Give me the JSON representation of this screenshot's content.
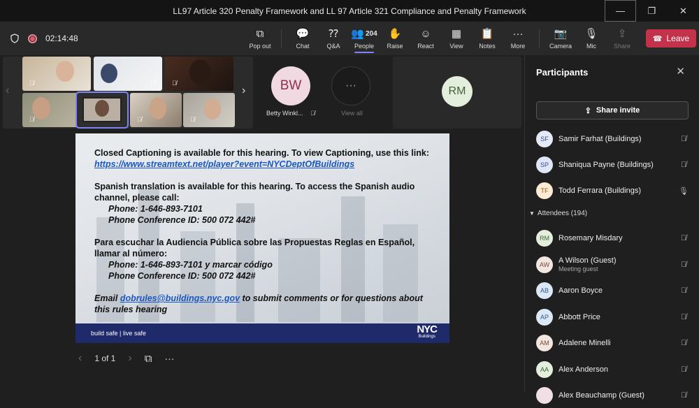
{
  "window": {
    "title": "LL97 Article 320 Penalty Framework and LL 97 Article 321 Compliance and Penalty Framework",
    "minimize": "—",
    "restore": "❐",
    "close": "✕"
  },
  "toolbar": {
    "timer": "02:14:48",
    "buttons": [
      {
        "label": "Pop out",
        "icon": "popout-icon",
        "glyph": "⧉"
      },
      {
        "label": "Chat",
        "icon": "chat-icon",
        "glyph": "💬"
      },
      {
        "label": "Q&A",
        "icon": "qa-icon",
        "glyph": "⁇"
      },
      {
        "label": "People",
        "icon": "people-icon",
        "glyph": "👥",
        "count": "204"
      },
      {
        "label": "Raise",
        "icon": "hand-icon",
        "glyph": "✋"
      },
      {
        "label": "React",
        "icon": "smile-icon",
        "glyph": "☺"
      },
      {
        "label": "View",
        "icon": "view-icon",
        "glyph": "▦"
      },
      {
        "label": "Notes",
        "icon": "notes-icon",
        "glyph": "📋"
      },
      {
        "label": "More",
        "icon": "more-icon",
        "glyph": "···"
      },
      {
        "label": "Camera",
        "icon": "camera-off-icon",
        "glyph": "📷"
      },
      {
        "label": "Mic",
        "icon": "mic-off-icon",
        "glyph": "🎙"
      },
      {
        "label": "Share",
        "icon": "share-icon",
        "glyph": "⇪"
      }
    ],
    "leave_label": "Leave"
  },
  "stage": {
    "betty_initials": "BW",
    "betty_name": "Betty Winkl...",
    "view_all_label": "View all",
    "view_all_glyph": "···",
    "rm_initials": "RM"
  },
  "slide": {
    "p1_a": "Closed Captioning is available for this hearing.  To view Captioning, use this link: ",
    "p1_link": "https://www.streamtext.net/player?event=NYCDeptOfBuildings",
    "p2_a": "Spanish translation is available for this hearing.  To access the Spanish audio channel, please call:",
    "p2_phone": "Phone: 1-646-893-7101",
    "p2_conf": "Phone Conference ID: 500 072 442#",
    "p3_a": "Para escuchar la Audiencia Pública sobre las Propuestas Reglas en Español, llamar al número:",
    "p3_phone": "Phone: 1-646-893-7101  y marcar código",
    "p3_conf": "Phone Conference ID: 500 072 442#",
    "p4_a": "Email ",
    "p4_link": "dobrules@buildings.nyc.gov",
    "p4_b": " to submit comments or for questions about this rules hearing",
    "footer_tag": "build safe | live safe",
    "footer_logo": "NYC",
    "footer_logo_sub": "Buildings"
  },
  "pager": {
    "prev": "‹",
    "page": "1 of 1",
    "next": "›",
    "grid": "⧉",
    "more": "···"
  },
  "panel": {
    "title": "Participants",
    "close": "✕",
    "invite_label": "Share invite",
    "presenters": [
      {
        "initials": "SF",
        "name": "Samir Farhat (Buildings)",
        "bg": "#e4e9f7",
        "fg": "#3a4b8c",
        "mic": "🎙̸"
      },
      {
        "initials": "SP",
        "name": "Shaniqua Payne (Buildings)",
        "bg": "#dfe6f7",
        "fg": "#3a4b8c",
        "mic": "🎙̸"
      },
      {
        "initials": "TF",
        "name": "Todd Ferrara (Buildings)",
        "bg": "#fbead4",
        "fg": "#8a5a1d",
        "mic": "🎙"
      }
    ],
    "attendees_label": "Attendees (194)",
    "attendees": [
      {
        "initials": "RM",
        "name": "Rosemary Misdary",
        "bg": "#e3eedc",
        "fg": "#44613a"
      },
      {
        "initials": "AW",
        "name": "A Wilson (Guest)",
        "sub": "Meeting guest",
        "bg": "#f1e6e0",
        "fg": "#7a4a34"
      },
      {
        "initials": "AB",
        "name": "Aaron Boyce",
        "bg": "#dbe9f6",
        "fg": "#2d5c8a"
      },
      {
        "initials": "AP",
        "name": "Abbott Price",
        "bg": "#dbe9f6",
        "fg": "#2d5c8a"
      },
      {
        "initials": "AM",
        "name": "Adalene Minelli",
        "bg": "#f1e6e0",
        "fg": "#7a4a34"
      },
      {
        "initials": "AA",
        "name": "Alex Anderson",
        "bg": "#e3eedc",
        "fg": "#44613a"
      },
      {
        "initials": "",
        "name": "Alex Beauchamp (Guest)",
        "bg": "#f1dfe6",
        "fg": "#7a3a55"
      }
    ]
  }
}
